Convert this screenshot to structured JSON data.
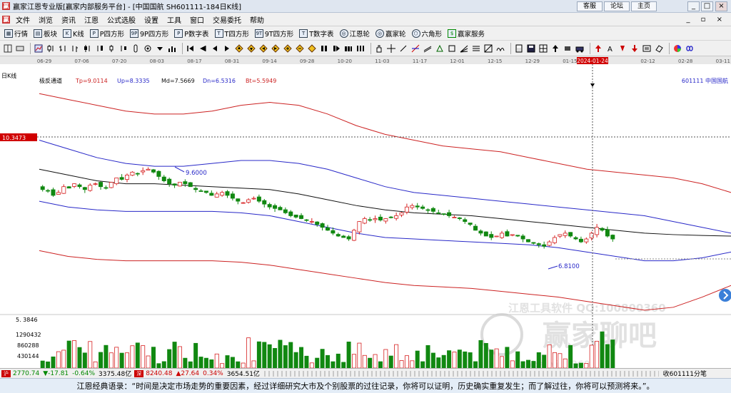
{
  "titlebar": {
    "title": "赢家江恩专业版[赢家内部服务平台] - [中国国航  SH601111-184日K线]",
    "buttons": [
      "客服",
      "论坛",
      "主页"
    ],
    "window_controls": [
      "_",
      "□",
      "×"
    ]
  },
  "menu": [
    "文件",
    "浏览",
    "资讯",
    "江恩",
    "公式选股",
    "设置",
    "工具",
    "窗口",
    "交易委托",
    "帮助"
  ],
  "toolbar1": [
    {
      "label": "行情",
      "icon": "▦"
    },
    {
      "label": "板块",
      "icon": "▤"
    },
    {
      "label": "K线",
      "icon": "K"
    },
    {
      "label": "P四方形",
      "icon": "P"
    },
    {
      "label": "9P四方形",
      "icon": "9P"
    },
    {
      "label": "P数字表",
      "icon": "P"
    },
    {
      "label": "T四方形",
      "icon": "T"
    },
    {
      "label": "9T四方形",
      "icon": "9T"
    },
    {
      "label": "T数字表",
      "icon": "T"
    },
    {
      "label": "江恩轮",
      "icon": "◎"
    },
    {
      "label": "赢家轮",
      "icon": "◎"
    },
    {
      "label": "六角形",
      "icon": "⬡"
    },
    {
      "label": "赢家服务",
      "icon": "$"
    }
  ],
  "chart": {
    "view_label": "日K线",
    "indicator": {
      "name": "极反通道",
      "tp": "Tp=9.0114",
      "up": "Up=8.3335",
      "md": "Md=7.5669",
      "dn": "Dn=6.5316",
      "bt": "Bt=5.5949"
    },
    "stock_label": "601111  中国国航",
    "dates": [
      "06-29",
      "07-06",
      "07-20",
      "08-03",
      "08-17",
      "08-31",
      "09-14",
      "09-28",
      "10-20",
      "11-03",
      "11-17",
      "12-01",
      "12-15",
      "12-29",
      "01-15",
      "2024-01-24",
      "02-12",
      "02-28",
      "03-11"
    ],
    "crosshair_price": "10.3473",
    "high_label": "9.6000",
    "low_label": "6.8100",
    "volume_labels": [
      "5. 3846",
      "1290432",
      "860288",
      "430144"
    ],
    "watermark_text": "江恩工具软件  QQ:100800360",
    "watermark_logo": "赢家聊吧",
    "watermark_url": "liaoba.wi... 360..."
  },
  "chart_data": {
    "type": "candlestick",
    "x_dates": [
      "06-29",
      "07-06",
      "07-20",
      "08-03",
      "08-17",
      "08-31",
      "09-14",
      "09-28",
      "10-20",
      "11-03",
      "11-17",
      "12-01",
      "12-15",
      "12-29",
      "01-15",
      "2024-01-24",
      "02-12",
      "02-28",
      "03-11"
    ],
    "closes": [
      8.9,
      8.85,
      8.7,
      8.8,
      9.0,
      8.95,
      9.1,
      9.0,
      8.9,
      9.05,
      9.1,
      9.0,
      8.95,
      9.15,
      9.3,
      9.25,
      9.4,
      9.5,
      9.45,
      9.55,
      9.6,
      9.5,
      9.35,
      9.2,
      9.1,
      9.05,
      9.15,
      9.1,
      9.0,
      8.9,
      8.85,
      8.8,
      8.7,
      8.75,
      8.8,
      8.7,
      8.6,
      8.5,
      8.45,
      8.55,
      8.6,
      8.5,
      8.4,
      8.3,
      8.25,
      8.2,
      8.1,
      8.0,
      7.95,
      7.9,
      7.85,
      7.8,
      7.7,
      7.6,
      7.5,
      7.4,
      7.3,
      7.25,
      7.2,
      7.5,
      7.8,
      7.9,
      7.85,
      7.9,
      7.85,
      7.9,
      7.95,
      8.0,
      8.1,
      8.3,
      8.35,
      8.3,
      8.25,
      8.2,
      8.15,
      8.1,
      8.05,
      8.0,
      7.95,
      7.9,
      7.8,
      7.7,
      7.5,
      7.4,
      7.3,
      7.25,
      7.3,
      7.4,
      7.3,
      7.35,
      7.3,
      7.2,
      7.1,
      7.05,
      7.0,
      6.95,
      7.1,
      7.25,
      7.35,
      7.4,
      7.3,
      7.2,
      7.1,
      7.2,
      7.4,
      7.6,
      7.5,
      7.3,
      7.2
    ],
    "channels": {
      "Tp": [
        12.2,
        12.0,
        11.8,
        11.6,
        11.5,
        11.5,
        11.6,
        11.8,
        11.9,
        11.8,
        11.5,
        11.1,
        10.8,
        10.6,
        10.4,
        10.3,
        10.2,
        10.0,
        9.8,
        9.6,
        9.5,
        9.4,
        9.3,
        9.1,
        8.8
      ],
      "Up": [
        10.6,
        10.3,
        10.0,
        9.8,
        9.7,
        9.7,
        9.8,
        9.9,
        9.9,
        9.8,
        9.6,
        9.3,
        9.0,
        8.8,
        8.7,
        8.6,
        8.5,
        8.4,
        8.3,
        8.2,
        8.1,
        8.0,
        7.8,
        7.6,
        7.4
      ],
      "Md": [
        9.6,
        9.4,
        9.2,
        9.1,
        9.1,
        9.05,
        9.0,
        8.95,
        8.9,
        8.75,
        8.55,
        8.35,
        8.2,
        8.1,
        8.05,
        8.0,
        7.9,
        7.8,
        7.7,
        7.6,
        7.5,
        7.4,
        7.35,
        7.32,
        7.3
      ],
      "Dn": [
        8.5,
        8.3,
        8.2,
        8.15,
        8.15,
        8.15,
        8.15,
        8.1,
        8.0,
        7.8,
        7.6,
        7.4,
        7.25,
        7.2,
        7.15,
        7.1,
        7.05,
        7.0,
        6.9,
        6.75,
        6.6,
        6.45,
        6.45,
        6.55,
        6.75
      ],
      "Bt": [
        6.8,
        6.6,
        6.5,
        6.45,
        6.45,
        6.45,
        6.45,
        6.4,
        6.3,
        6.15,
        6.0,
        5.85,
        5.7,
        5.6,
        5.55,
        5.5,
        5.4,
        5.3,
        5.2,
        5.05,
        4.9,
        4.75,
        4.85,
        5.2,
        5.6
      ]
    },
    "ylim": [
      4.6,
      12.6
    ]
  },
  "statusbar": {
    "idx1": "2770.74",
    "idx1_chg": "▼-17.81",
    "idx1_pct": "-0.64%",
    "idx1_vol": "3375.48亿",
    "idx2": "8240.48",
    "idx2_chg": "▲27.64",
    "idx2_pct": "0.34%",
    "idx2_vol": "3654.51亿",
    "right": "收601111分笔"
  },
  "quote": "江恩经典语录：“时间是决定市场走势的重要因素，经过详细研究大市及个别股票的过往记录，你将可以证明，历史确实重复发生；而了解过往，你将可以预测将来。”。",
  "colors": {
    "up": "#d62020",
    "down": "#118811",
    "top_channel": "#cc2222",
    "mid_blue": "#2828c8",
    "middle": "#111111",
    "price_box": "#d00000"
  }
}
